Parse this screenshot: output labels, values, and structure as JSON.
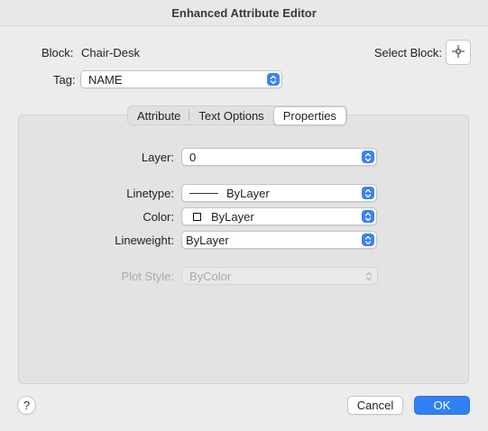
{
  "window": {
    "title": "Enhanced Attribute Editor"
  },
  "header": {
    "block_label": "Block:",
    "block_value": "Chair-Desk",
    "select_block_label": "Select Block:",
    "select_block_icon": "crosshair-pick-icon",
    "tag_label": "Tag:",
    "tag_value": "NAME"
  },
  "tabs": [
    {
      "label": "Attribute",
      "active": false
    },
    {
      "label": "Text Options",
      "active": false
    },
    {
      "label": "Properties",
      "active": true
    }
  ],
  "properties": {
    "layer_label": "Layer:",
    "layer_value": "0",
    "linetype_label": "Linetype:",
    "linetype_value": "ByLayer",
    "color_label": "Color:",
    "color_value": "ByLayer",
    "lineweight_label": "Lineweight:",
    "lineweight_value": "ByLayer",
    "plotstyle_label": "Plot Style:",
    "plotstyle_value": "ByColor"
  },
  "footer": {
    "help_label": "?",
    "cancel_label": "Cancel",
    "ok_label": "OK"
  },
  "colors": {
    "accent": "#2f80f5",
    "stepper": "#3b82f6",
    "window_bg": "#ececec",
    "panel_bg": "#e3e3e3"
  }
}
